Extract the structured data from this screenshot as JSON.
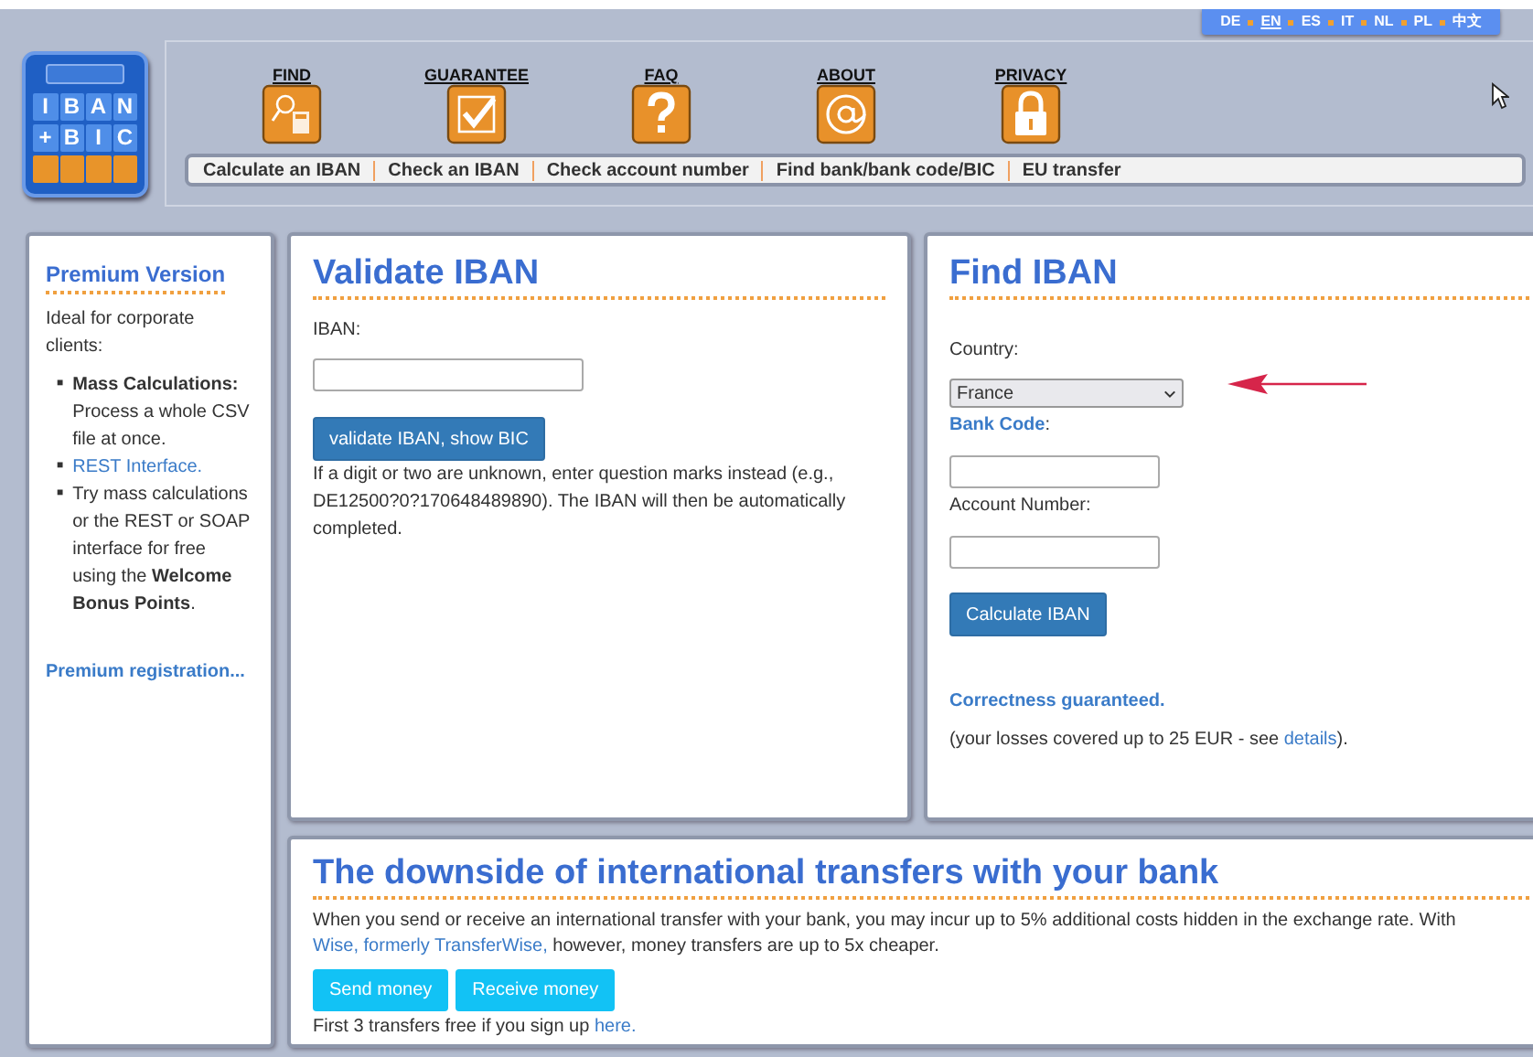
{
  "languages": [
    {
      "label": "DE",
      "selected": false
    },
    {
      "label": "EN",
      "selected": true
    },
    {
      "label": "ES",
      "selected": false
    },
    {
      "label": "IT",
      "selected": false
    },
    {
      "label": "NL",
      "selected": false
    },
    {
      "label": "PL",
      "selected": false
    },
    {
      "label": "中文",
      "selected": false
    }
  ],
  "logo": {
    "top_row": [
      "I",
      "B",
      "A",
      "N"
    ],
    "bottom_row": [
      "+",
      "B",
      "I",
      "C"
    ]
  },
  "nav_icons": [
    {
      "label": "FIND",
      "kind": "find"
    },
    {
      "label": "GUARANTEE",
      "kind": "check"
    },
    {
      "label": "FAQ",
      "kind": "question"
    },
    {
      "label": "ABOUT",
      "kind": "at"
    },
    {
      "label": "PRIVACY",
      "kind": "lock"
    }
  ],
  "nav_links": [
    "Calculate an IBAN",
    "Check an IBAN",
    "Check account number",
    "Find bank/bank code/BIC",
    "EU transfer"
  ],
  "sidebar": {
    "title": "Premium Version",
    "intro": "Ideal for corporate clients:",
    "bullets": [
      {
        "kind": "text",
        "marker": "■",
        "text": "**Mass Calculations:** Process a whole CSV file at once."
      },
      {
        "kind": "link",
        "marker": "■",
        "text": "REST Interface."
      },
      {
        "kind": "text",
        "marker": "■",
        "text": "Try mass calculations or the REST or SOAP interface for free using the **Welcome Bonus Points**."
      }
    ],
    "link": "Premium registration..."
  },
  "validate": {
    "title": "Validate IBAN",
    "label": "IBAN:",
    "button": "validate IBAN, show BIC",
    "help": "If a digit or two are unknown, enter question marks instead (e.g., DE12500?0?170648489890). The IBAN will then be automatically completed."
  },
  "find": {
    "title": "Find IBAN",
    "fields": [
      {
        "kind": "select",
        "label": "Country:",
        "value": "France"
      },
      {
        "kind": "input",
        "label_link": "Bank Code",
        "label": ":"
      },
      {
        "kind": "input",
        "label": "Account Number:"
      }
    ],
    "button": "Calculate IBAN",
    "guarantee": "Correctness guaranteed.",
    "note": [
      {
        "text": "(your losses covered up to 25 EUR - see ",
        "link": false
      },
      {
        "text": "details",
        "link": true
      },
      {
        "text": ").",
        "link": false
      }
    ]
  },
  "transfers": {
    "title": "The downside of international transfers with your bank",
    "text": [
      {
        "text": "When you send or receive an international transfer with your bank, you may incur up to 5% additional costs hidden in the exchange rate. With ",
        "link": false
      },
      {
        "text": "Wise, formerly TransferWise,",
        "link": true
      },
      {
        "text": " however, money transfers are up to 5x cheaper.",
        "link": false
      }
    ],
    "buttons": [
      "Send money",
      "Receive money"
    ],
    "footer": [
      {
        "text": "First 3 transfers free if you sign up ",
        "link": false
      },
      {
        "text": "here.",
        "link": true
      }
    ]
  }
}
